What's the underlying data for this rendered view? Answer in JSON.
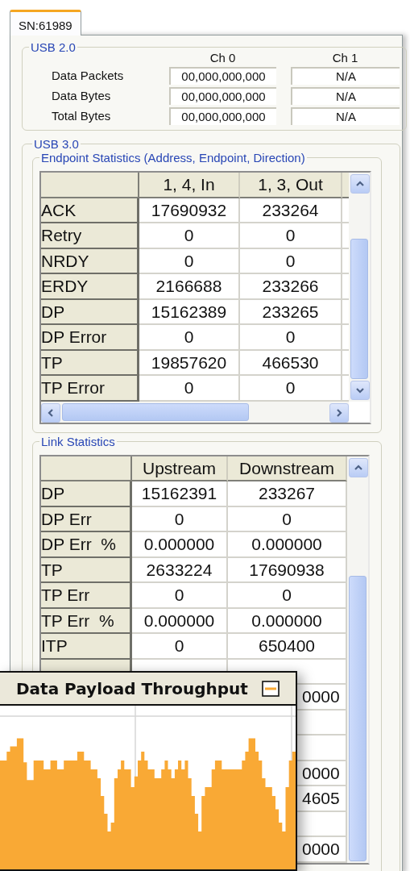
{
  "tab": {
    "label": "SN:61989",
    "selected": true
  },
  "usb2": {
    "title": "USB 2.0",
    "columns": [
      "Ch 0",
      "Ch 1"
    ],
    "rows": [
      {
        "label": "Data Packets",
        "values": [
          "00,000,000,000",
          "N/A"
        ]
      },
      {
        "label": "Data Bytes",
        "values": [
          "00,000,000,000",
          "N/A"
        ]
      },
      {
        "label": "Total Bytes",
        "values": [
          "00,000,000,000",
          "N/A"
        ]
      }
    ]
  },
  "usb3": {
    "title": "USB 3.0",
    "endpoint_stats": {
      "title": "Endpoint Statistics (Address, Endpoint, Direction)",
      "columns": [
        "1, 4, In",
        "1, 3, Out"
      ],
      "rows": [
        {
          "label": "ACK",
          "values": [
            "17690932",
            "233264"
          ]
        },
        {
          "label": "Retry",
          "values": [
            "0",
            "0"
          ]
        },
        {
          "label": "NRDY",
          "values": [
            "0",
            "0"
          ]
        },
        {
          "label": "ERDY",
          "values": [
            "2166688",
            "233266"
          ]
        },
        {
          "label": "DP",
          "values": [
            "15162389",
            "233265"
          ]
        },
        {
          "label": "DP Error",
          "values": [
            "0",
            "0"
          ]
        },
        {
          "label": "TP",
          "values": [
            "19857620",
            "466530"
          ]
        },
        {
          "label": "TP Error",
          "values": [
            "0",
            "0"
          ]
        }
      ]
    },
    "link_stats": {
      "title": "Link Statistics",
      "columns": [
        "Upstream",
        "Downstream"
      ],
      "rows": [
        {
          "kind": "full",
          "label": "DP",
          "values": [
            "15162391",
            "233267"
          ]
        },
        {
          "kind": "full",
          "label": "DP Err",
          "values": [
            "0",
            "0"
          ]
        },
        {
          "kind": "full",
          "label": "DP Err  %",
          "values": [
            "0.000000",
            "0.000000"
          ]
        },
        {
          "kind": "full",
          "label": "TP",
          "values": [
            "2633224",
            "17690938"
          ]
        },
        {
          "kind": "full",
          "label": "TP Err",
          "values": [
            "0",
            "0"
          ]
        },
        {
          "kind": "full",
          "label": "TP Err  %",
          "values": [
            "0.000000",
            "0.000000"
          ]
        },
        {
          "kind": "full",
          "label": "ITP",
          "values": [
            "0",
            "650400"
          ]
        },
        {
          "kind": "covered"
        },
        {
          "kind": "covered",
          "fragment": "0000"
        },
        {
          "kind": "covered"
        },
        {
          "kind": "covered"
        },
        {
          "kind": "covered",
          "fragment": "0000"
        },
        {
          "kind": "covered",
          "fragment": "4605"
        },
        {
          "kind": "covered"
        },
        {
          "kind": "covered",
          "fragment": "0000"
        }
      ]
    }
  },
  "chart_window": {
    "title": "Data Payload Throughput"
  }
}
